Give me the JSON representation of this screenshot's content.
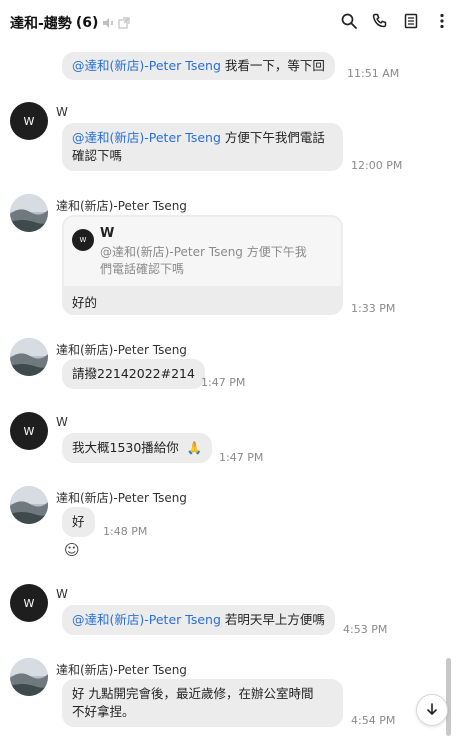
{
  "header": {
    "title": "達和-趨勢",
    "member_count": "(6)"
  },
  "messages": [
    {
      "text_mention": "@達和(新店)-Peter Tseng",
      "text": " 我看一下，等下回",
      "time": "11:51 AM"
    },
    {
      "sender": "W",
      "avatar_letter": "W",
      "text_mention": "@達和(新店)-Peter Tseng",
      "text_line1": " 方便下午我們電話",
      "text_line2": "確認下嗎",
      "time": "12:00 PM"
    },
    {
      "sender": "達和(新店)-Peter Tseng",
      "reply_name": "W",
      "reply_avatar_letter": "W",
      "reply_line1": "@達和(新店)-Peter Tseng 方便下午我",
      "reply_line2": "們電話確認下嗎",
      "text": "好的",
      "time": "1:33 PM"
    },
    {
      "sender": "達和(新店)-Peter Tseng",
      "text": "請撥22142022#214",
      "time": "1:47 PM"
    },
    {
      "sender": "W",
      "avatar_letter": "W",
      "text": "我大概1530播給你",
      "emoji": "🙏",
      "time": "1:47 PM"
    },
    {
      "sender": "達和(新店)-Peter Tseng",
      "text": "好",
      "time": "1:48 PM",
      "sticker": "☺"
    },
    {
      "sender": "W",
      "avatar_letter": "W",
      "text_mention": "@達和(新店)-Peter Tseng",
      "text": " 若明天早上方便嗎",
      "time": "4:53 PM"
    },
    {
      "sender": "達和(新店)-Peter Tseng",
      "text_line1": "好 九點開完會後，最近歲修，在辦公室時間",
      "text_line2": "不好拿捏。",
      "time": "4:54 PM"
    }
  ],
  "icons": {
    "mute": "speaker-muted-icon",
    "external": "external-window-icon",
    "search": "search-icon",
    "call": "phone-icon",
    "notes": "notes-icon",
    "more": "more-vertical-icon",
    "scroll_down": "arrow-down-icon"
  },
  "colors": {
    "mention": "#2a6fd4",
    "bubble": "#ececec",
    "avatar_w": "#1e1e1e"
  }
}
